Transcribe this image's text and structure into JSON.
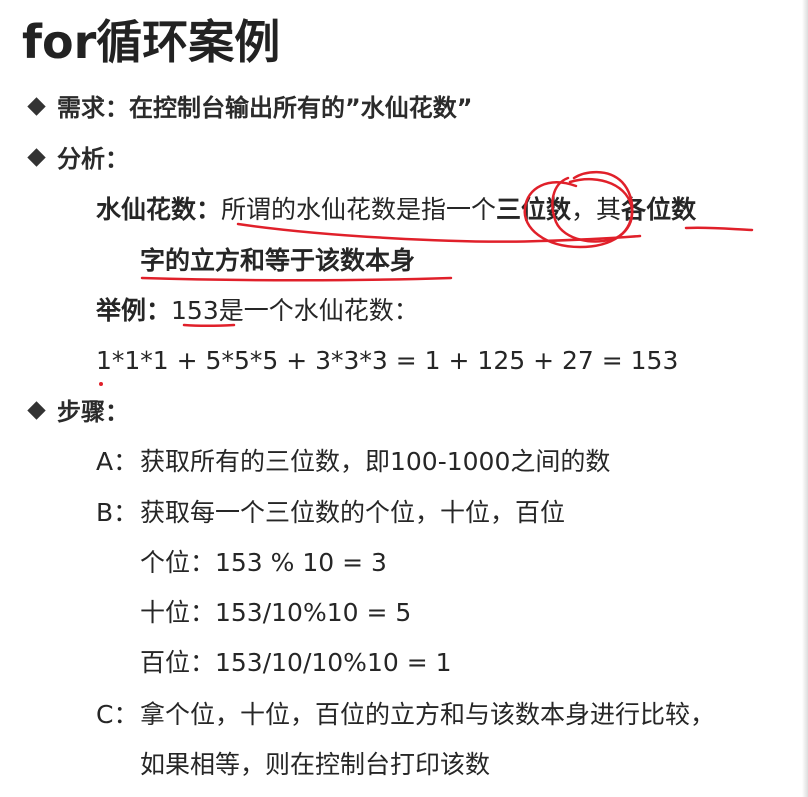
{
  "title": "for循环案例",
  "requirement": {
    "label": "需求：",
    "text": "在控制台输出所有的”水仙花数”"
  },
  "analysis": {
    "label": "分析：",
    "definition": {
      "term": "水仙花数：",
      "text_plain_1": "所谓的水仙花数是指一个",
      "text_bold_1": "三位数",
      "text_plain_2": "，其",
      "text_bold_2": "各位数",
      "text_bold_3": "字的立方和等于该数本身"
    },
    "example": {
      "term": "举例：",
      "text": "153是一个水仙花数：",
      "formula": "1*1*1 + 5*5*5 + 3*3*3 = 1 + 125 + 27 = 153"
    }
  },
  "steps": {
    "label": "步骤：",
    "items": [
      {
        "letter": "A：",
        "text": "获取所有的三位数，即100-1000之间的数"
      },
      {
        "letter": "B：",
        "text": "获取每一个三位数的个位，十位，百位"
      },
      {
        "letter": "",
        "text": "个位：153 % 10 = 3"
      },
      {
        "letter": "",
        "text": "十位：153/10%10 = 5"
      },
      {
        "letter": "",
        "text": "百位：153/10/10%10 = 1"
      },
      {
        "letter": "C：",
        "text": "拿个位，十位，百位的立方和与该数本身进行比较，"
      },
      {
        "letter": "",
        "text": "如果相等，则在控制台打印该数"
      }
    ]
  },
  "colors": {
    "text": "#262626",
    "annotation": "#e0202a",
    "bullet": "#333333"
  }
}
